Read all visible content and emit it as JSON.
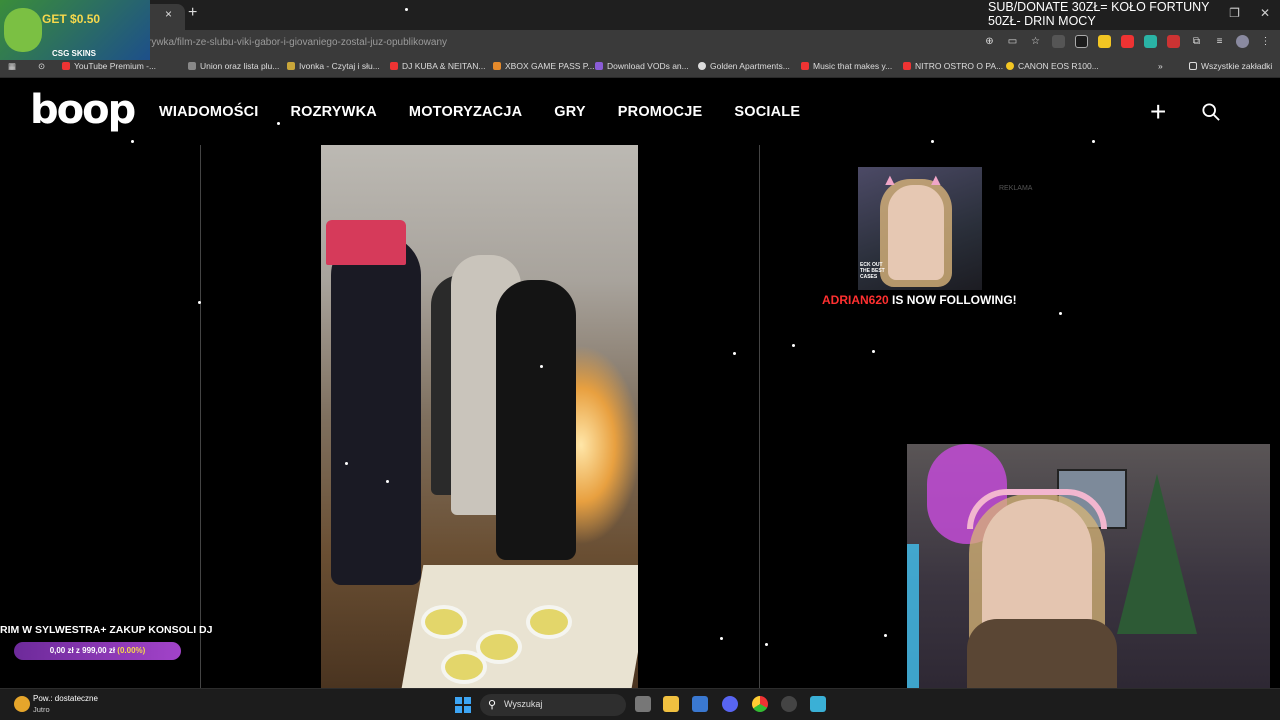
{
  "browser": {
    "tab_close": "×",
    "new_tab": "+",
    "url": "rywka/film-ze-slubu-viki-gabor-i-giovaniego-zostal-juz-opublikowany",
    "bookmarks": [
      {
        "label": "YouTube Premium -...",
        "color": "#e33"
      },
      {
        "label": "Union oraz lista plu...",
        "color": "#888"
      },
      {
        "label": "Ivonka - Czytaj i słu...",
        "color": "#c9a63a"
      },
      {
        "label": "DJ KUBA & NEITAN...",
        "color": "#e33"
      },
      {
        "label": "XBOX GAME PASS P...",
        "color": "#e58a2b"
      },
      {
        "label": "Download VODs an...",
        "color": "#8a5cd6"
      },
      {
        "label": "Golden Apartments...",
        "color": "#ddd"
      },
      {
        "label": "Music that makes y...",
        "color": "#e33"
      },
      {
        "label": "NITRO OSTRO O PA...",
        "color": "#e33"
      },
      {
        "label": "CANON EOS R100...",
        "color": "#f3c623"
      }
    ],
    "all_bookmarks": "Wszystkie zakładki"
  },
  "site": {
    "logo": "boop",
    "nav": [
      "WIADOMOŚCI",
      "ROZRYWKA",
      "MOTORYZACJA",
      "GRY",
      "PROMOCJE",
      "SOCIALE"
    ],
    "plus": "+",
    "ad_label": "REKLAMA"
  },
  "overlay": {
    "banner_get": "GET ",
    "banner_amount": "$0.50",
    "banner_brand": "CSG SKINS",
    "donate_text": "SUB/DONATE 30ZŁ= KOŁO FORTUNY 50ZŁ- DRIN MOCY",
    "follow_card_text": "ECK OUT THE BEST CASES",
    "follow_name": "ADRIAN620",
    "follow_suffix": " IS NOW FOLLOWING!",
    "goal_title": "RIM W SYLWESTRA+ ZAKUP KONSOLI DJ",
    "goal_value": "0,00 zł z 999,00 zł ",
    "goal_percent": "(0.00%)",
    "goal_progress": 0
  },
  "taskbar": {
    "weather_line1": "Pow.: dostateczne",
    "weather_line2": "Jutro",
    "search_placeholder": "Wyszukaj"
  },
  "colors": {
    "accent_purple": "#a243c9",
    "follow_red": "#ff3030",
    "windows_blue": "#3da5f4"
  }
}
